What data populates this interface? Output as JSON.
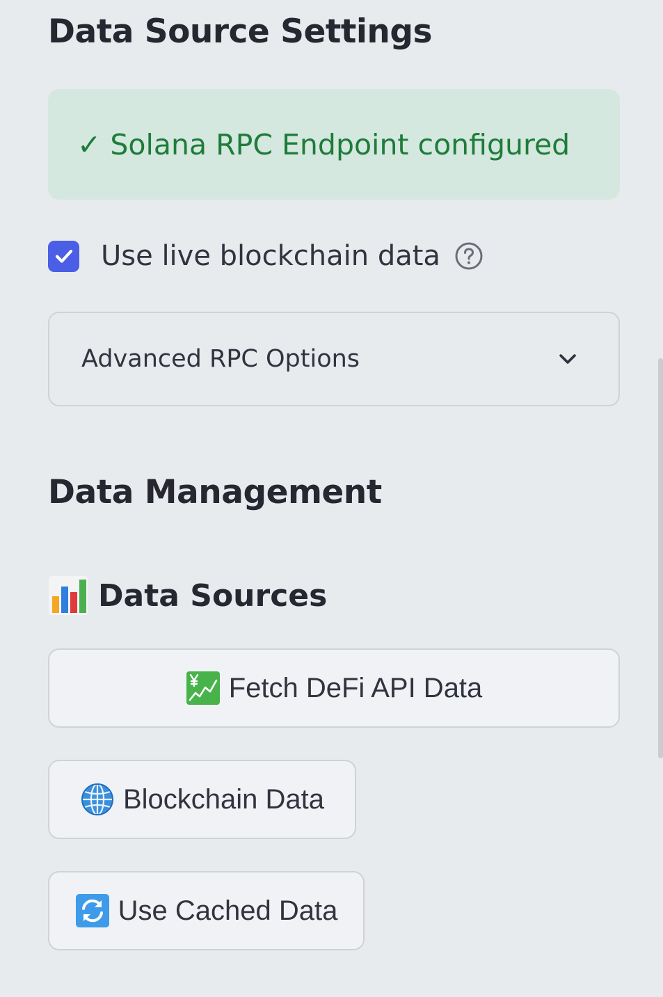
{
  "settings": {
    "title": "Data Source Settings",
    "status_message": "✓ Solana RPC Endpoint configured",
    "live_data_checkbox": {
      "label": "Use live blockchain data",
      "checked": true
    },
    "advanced_expander_label": "Advanced RPC Options"
  },
  "management": {
    "title": "Data Management",
    "sources_subheader": "Data Sources",
    "buttons": {
      "fetch_defi": "Fetch DeFi API Data",
      "blockchain": "Blockchain Data",
      "cached": "Use Cached Data"
    }
  },
  "colors": {
    "background": "#e8ebee",
    "success_bg": "#d4e8df",
    "success_text": "#1e7c3a",
    "checkbox_accent": "#4b5ee6"
  },
  "icons": {
    "subheader": "bar-chart-icon",
    "fetch_defi": "chart-yen-icon",
    "blockchain": "globe-icon",
    "cached": "refresh-icon",
    "help": "help-circle-icon",
    "expander": "chevron-down-icon"
  }
}
